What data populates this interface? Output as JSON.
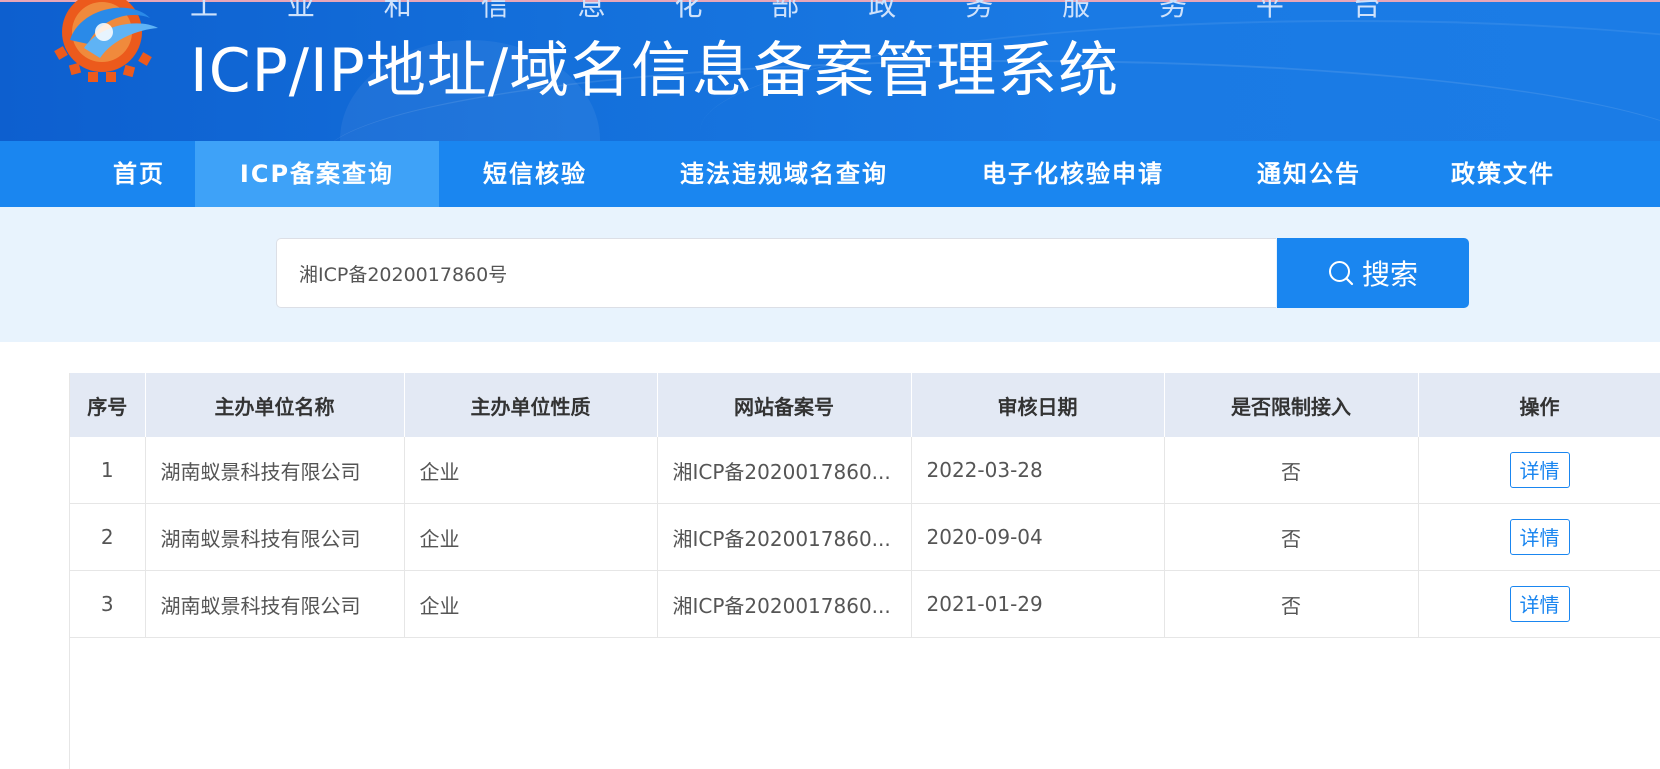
{
  "header": {
    "subtitle": "工 业 和 信 息 化 部 政 务 服 务 平 台",
    "title": "ICP/IP地址/域名信息备案管理系统"
  },
  "nav": {
    "items": [
      {
        "label": "首页"
      },
      {
        "label": "ICP备案查询",
        "active": true
      },
      {
        "label": "短信核验"
      },
      {
        "label": "违法违规域名查询"
      },
      {
        "label": "电子化核验申请"
      },
      {
        "label": "通知公告"
      },
      {
        "label": "政策文件"
      }
    ]
  },
  "search": {
    "value": "湘ICP备2020017860号",
    "button_label": "搜索",
    "button_icon": "search-icon"
  },
  "table": {
    "headers": [
      "序号",
      "主办单位名称",
      "主办单位性质",
      "网站备案号",
      "审核日期",
      "是否限制接入",
      "操作"
    ],
    "rows": [
      {
        "index": "1",
        "org": "湖南蚁景科技有限公司",
        "type": "企业",
        "record": "湘ICP备2020017860...",
        "date": "2022-03-28",
        "restricted": "否",
        "action": "详情"
      },
      {
        "index": "2",
        "org": "湖南蚁景科技有限公司",
        "type": "企业",
        "record": "湘ICP备2020017860...",
        "date": "2020-09-04",
        "restricted": "否",
        "action": "详情"
      },
      {
        "index": "3",
        "org": "湖南蚁景科技有限公司",
        "type": "企业",
        "record": "湘ICP备2020017860...",
        "date": "2021-01-29",
        "restricted": "否",
        "action": "详情"
      }
    ]
  },
  "colors": {
    "nav_bg": "#1a86f0",
    "nav_active": "#3ea2f8",
    "banner": "#1470db",
    "search_area_bg": "#e8f3fd",
    "table_header_bg": "#e3e9f4",
    "logo_orange": "#ec5a1c"
  }
}
